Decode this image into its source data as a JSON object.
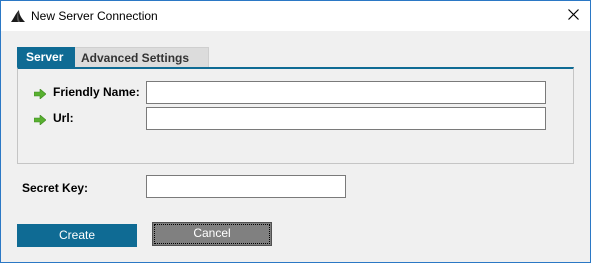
{
  "window": {
    "title": "New Server Connection",
    "app_icon": "shark-fin-icon",
    "close_icon": "close-icon"
  },
  "tabs": [
    {
      "label": "Server",
      "selected": true
    },
    {
      "label": "Advanced Settings",
      "selected": false
    }
  ],
  "server_tab": {
    "friendly_name": {
      "label": "Friendly Name:",
      "value": "",
      "icon": "green-arrow-icon"
    },
    "url": {
      "label": "Url:",
      "value": "",
      "icon": "green-arrow-icon"
    }
  },
  "secret_key": {
    "label": "Secret Key:",
    "value": ""
  },
  "buttons": {
    "create": "Create",
    "cancel": "Cancel"
  },
  "colors": {
    "accent": "#0f6b94",
    "window_border": "#2b78c5",
    "arrow": "#58b030",
    "cancel_bg": "#808080"
  }
}
